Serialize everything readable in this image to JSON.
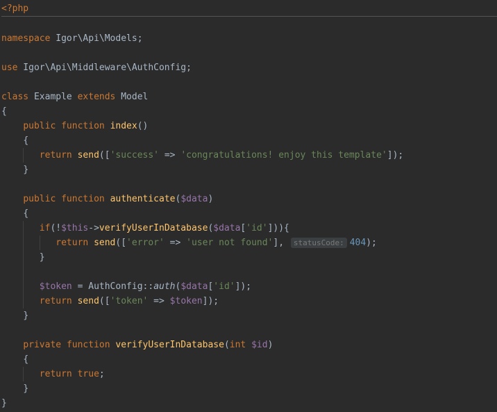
{
  "l1": "<?php",
  "l3_ns": "namespace",
  "l3_path": " Igor\\Api\\Models",
  "l3_semi": ";",
  "l5_use": "use",
  "l5_path": " Igor\\Api\\Middleware\\AuthConfig",
  "l5_semi": ";",
  "l7_class": "class",
  "l7_name": " Example ",
  "l7_ext": "extends",
  "l7_model": " Model",
  "l8": "{",
  "l9_pub": "public",
  "l9_fn": "function",
  "l9_name": "index",
  "l10": "{",
  "l11_ret": "return",
  "l11_send": "send",
  "l11_key": "'success'",
  "l11_arrow": " => ",
  "l11_val": "'congratulations! enjoy this template'",
  "l12": "}",
  "l14_pub": "public",
  "l14_fn": "function",
  "l14_name": "authenticate",
  "l14_param": "$data",
  "l15": "{",
  "l16_if": "if",
  "l16_this": "$this",
  "l16_arrow": "->",
  "l16_verify": "verifyUserInDatabase",
  "l16_data": "$data",
  "l16_id": "'id'",
  "l17_ret": "return",
  "l17_send": "send",
  "l17_key": "'error'",
  "l17_arrow": " => ",
  "l17_val": "'user not found'",
  "l17_hint": "statusCode:",
  "l17_num": "404",
  "l18": "}",
  "l20_tok": "$token",
  "l20_ac": "AuthConfig",
  "l20_auth": "auth",
  "l20_data": "$data",
  "l20_id": "'id'",
  "l21_ret": "return",
  "l21_send": "send",
  "l21_key": "'token'",
  "l21_arrow": " => ",
  "l21_tok": "$token",
  "l22": "}",
  "l24_priv": "private",
  "l24_fn": "function",
  "l24_name": "verifyUserInDatabase",
  "l24_int": "int",
  "l24_id": "$id",
  "l25": "{",
  "l26_ret": "return",
  "l26_true": "true",
  "l27": "}",
  "l28": "}"
}
